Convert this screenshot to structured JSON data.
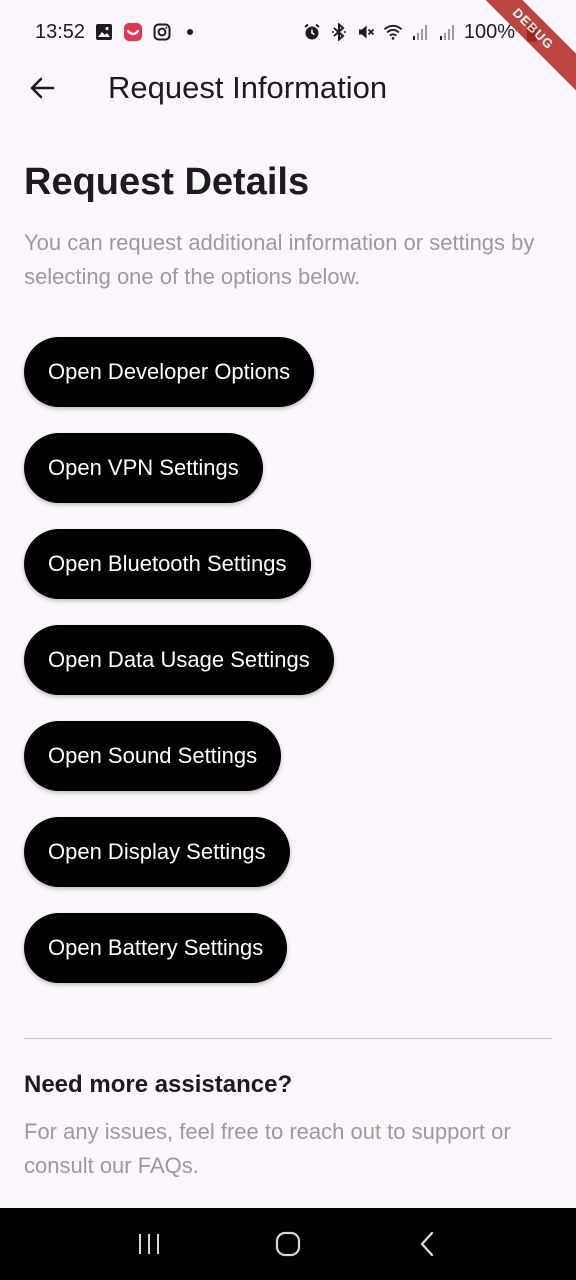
{
  "status_bar": {
    "time": "13:52",
    "battery": "100%",
    "icons_left": [
      "gallery-icon",
      "app-notification-icon",
      "instagram-icon"
    ],
    "icons_right": [
      "alarm-icon",
      "bluetooth-icon",
      "mute-icon",
      "wifi-icon",
      "signal-icon",
      "signal-icon",
      "battery-icon"
    ]
  },
  "debug_banner": "DEBUG",
  "app_bar": {
    "title": "Request Information",
    "back_icon": "back-arrow-icon"
  },
  "main": {
    "heading": "Request Details",
    "description": "You can request additional information or settings by selecting one of the options below.",
    "buttons": [
      {
        "label": "Open Developer Options"
      },
      {
        "label": "Open VPN Settings"
      },
      {
        "label": "Open Bluetooth Settings"
      },
      {
        "label": "Open Data Usage Settings"
      },
      {
        "label": "Open Sound Settings"
      },
      {
        "label": "Open Display Settings"
      },
      {
        "label": "Open Battery Settings"
      }
    ]
  },
  "assistance": {
    "heading": "Need more assistance?",
    "description": "For any issues, feel free to reach out to support or consult our FAQs."
  },
  "nav_bar": {
    "items": [
      "recents-icon",
      "home-icon",
      "back-icon"
    ]
  },
  "colors": {
    "background": "#fdf7fd",
    "button_bg": "#000000",
    "button_text": "#ffffff",
    "muted_text": "#9b9a9f"
  }
}
